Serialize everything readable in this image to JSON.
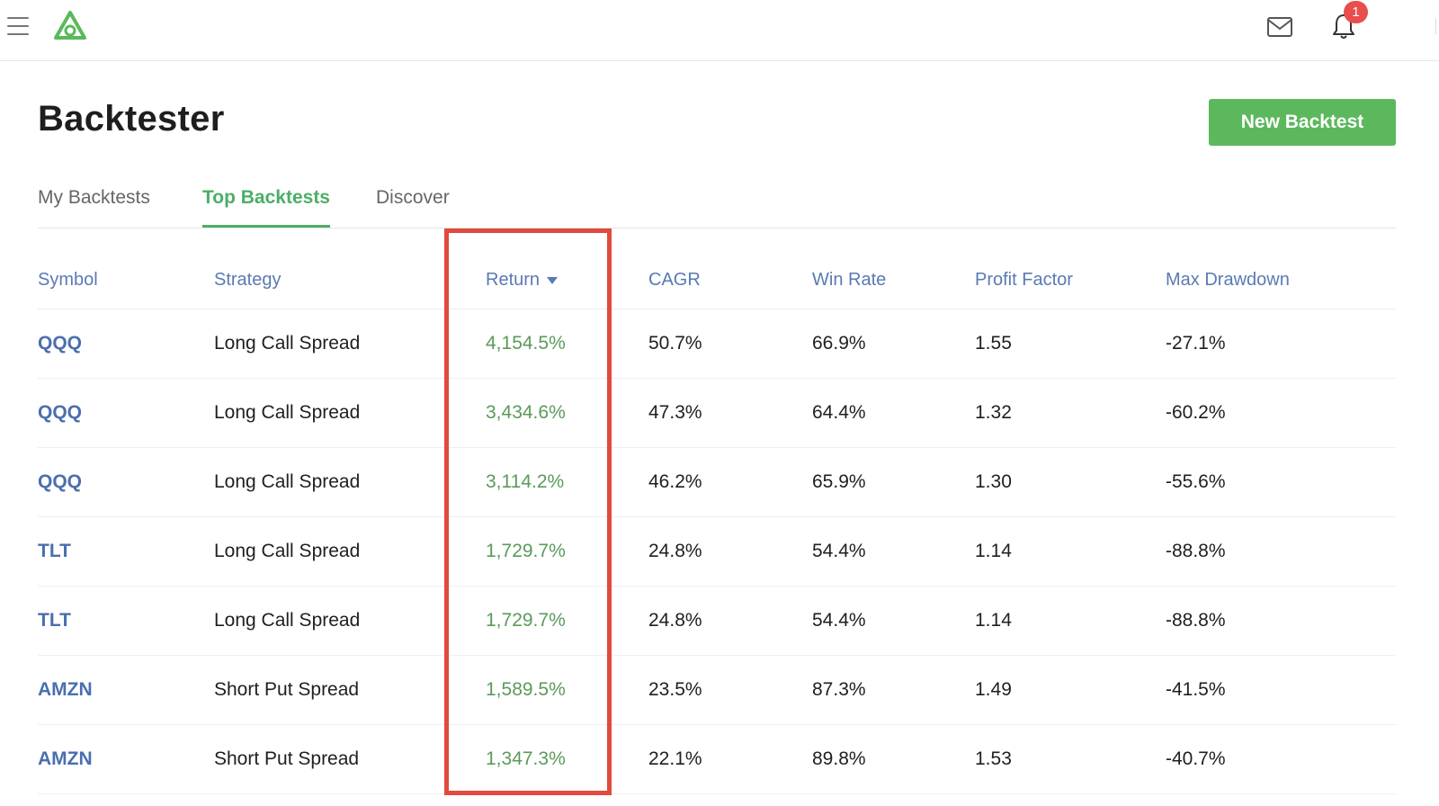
{
  "topbar": {
    "notification_count": "1"
  },
  "page": {
    "title": "Backtester",
    "new_button_label": "New Backtest"
  },
  "tabs": [
    {
      "label": "My Backtests",
      "active": false
    },
    {
      "label": "Top Backtests",
      "active": true
    },
    {
      "label": "Discover",
      "active": false
    }
  ],
  "table": {
    "headers": {
      "symbol": "Symbol",
      "strategy": "Strategy",
      "return": "Return",
      "cagr": "CAGR",
      "win_rate": "Win Rate",
      "profit_factor": "Profit Factor",
      "max_drawdown": "Max Drawdown"
    },
    "rows": [
      {
        "symbol": "QQQ",
        "strategy": "Long Call Spread",
        "return": "4,154.5%",
        "cagr": "50.7%",
        "win_rate": "66.9%",
        "profit_factor": "1.55",
        "max_drawdown": "-27.1%"
      },
      {
        "symbol": "QQQ",
        "strategy": "Long Call Spread",
        "return": "3,434.6%",
        "cagr": "47.3%",
        "win_rate": "64.4%",
        "profit_factor": "1.32",
        "max_drawdown": "-60.2%"
      },
      {
        "symbol": "QQQ",
        "strategy": "Long Call Spread",
        "return": "3,114.2%",
        "cagr": "46.2%",
        "win_rate": "65.9%",
        "profit_factor": "1.30",
        "max_drawdown": "-55.6%"
      },
      {
        "symbol": "TLT",
        "strategy": "Long Call Spread",
        "return": "1,729.7%",
        "cagr": "24.8%",
        "win_rate": "54.4%",
        "profit_factor": "1.14",
        "max_drawdown": "-88.8%"
      },
      {
        "symbol": "TLT",
        "strategy": "Long Call Spread",
        "return": "1,729.7%",
        "cagr": "24.8%",
        "win_rate": "54.4%",
        "profit_factor": "1.14",
        "max_drawdown": "-88.8%"
      },
      {
        "symbol": "AMZN",
        "strategy": "Short Put Spread",
        "return": "1,589.5%",
        "cagr": "23.5%",
        "win_rate": "87.3%",
        "profit_factor": "1.49",
        "max_drawdown": "-41.5%"
      },
      {
        "symbol": "AMZN",
        "strategy": "Short Put Spread",
        "return": "1,347.3%",
        "cagr": "22.1%",
        "win_rate": "89.8%",
        "profit_factor": "1.53",
        "max_drawdown": "-40.7%"
      }
    ]
  },
  "icons": {
    "menu": "hamburger-menu-icon",
    "logo": "triangle-logo-icon",
    "mail": "mail-icon",
    "bell": "bell-icon",
    "sort": "sort-descending-icon"
  },
  "colors": {
    "accent_green": "#5cb85c",
    "link_blue": "#4a6fae",
    "return_green": "#5b9a5b",
    "highlight_red": "#e04a3f",
    "badge_red": "#ea4d4d"
  }
}
